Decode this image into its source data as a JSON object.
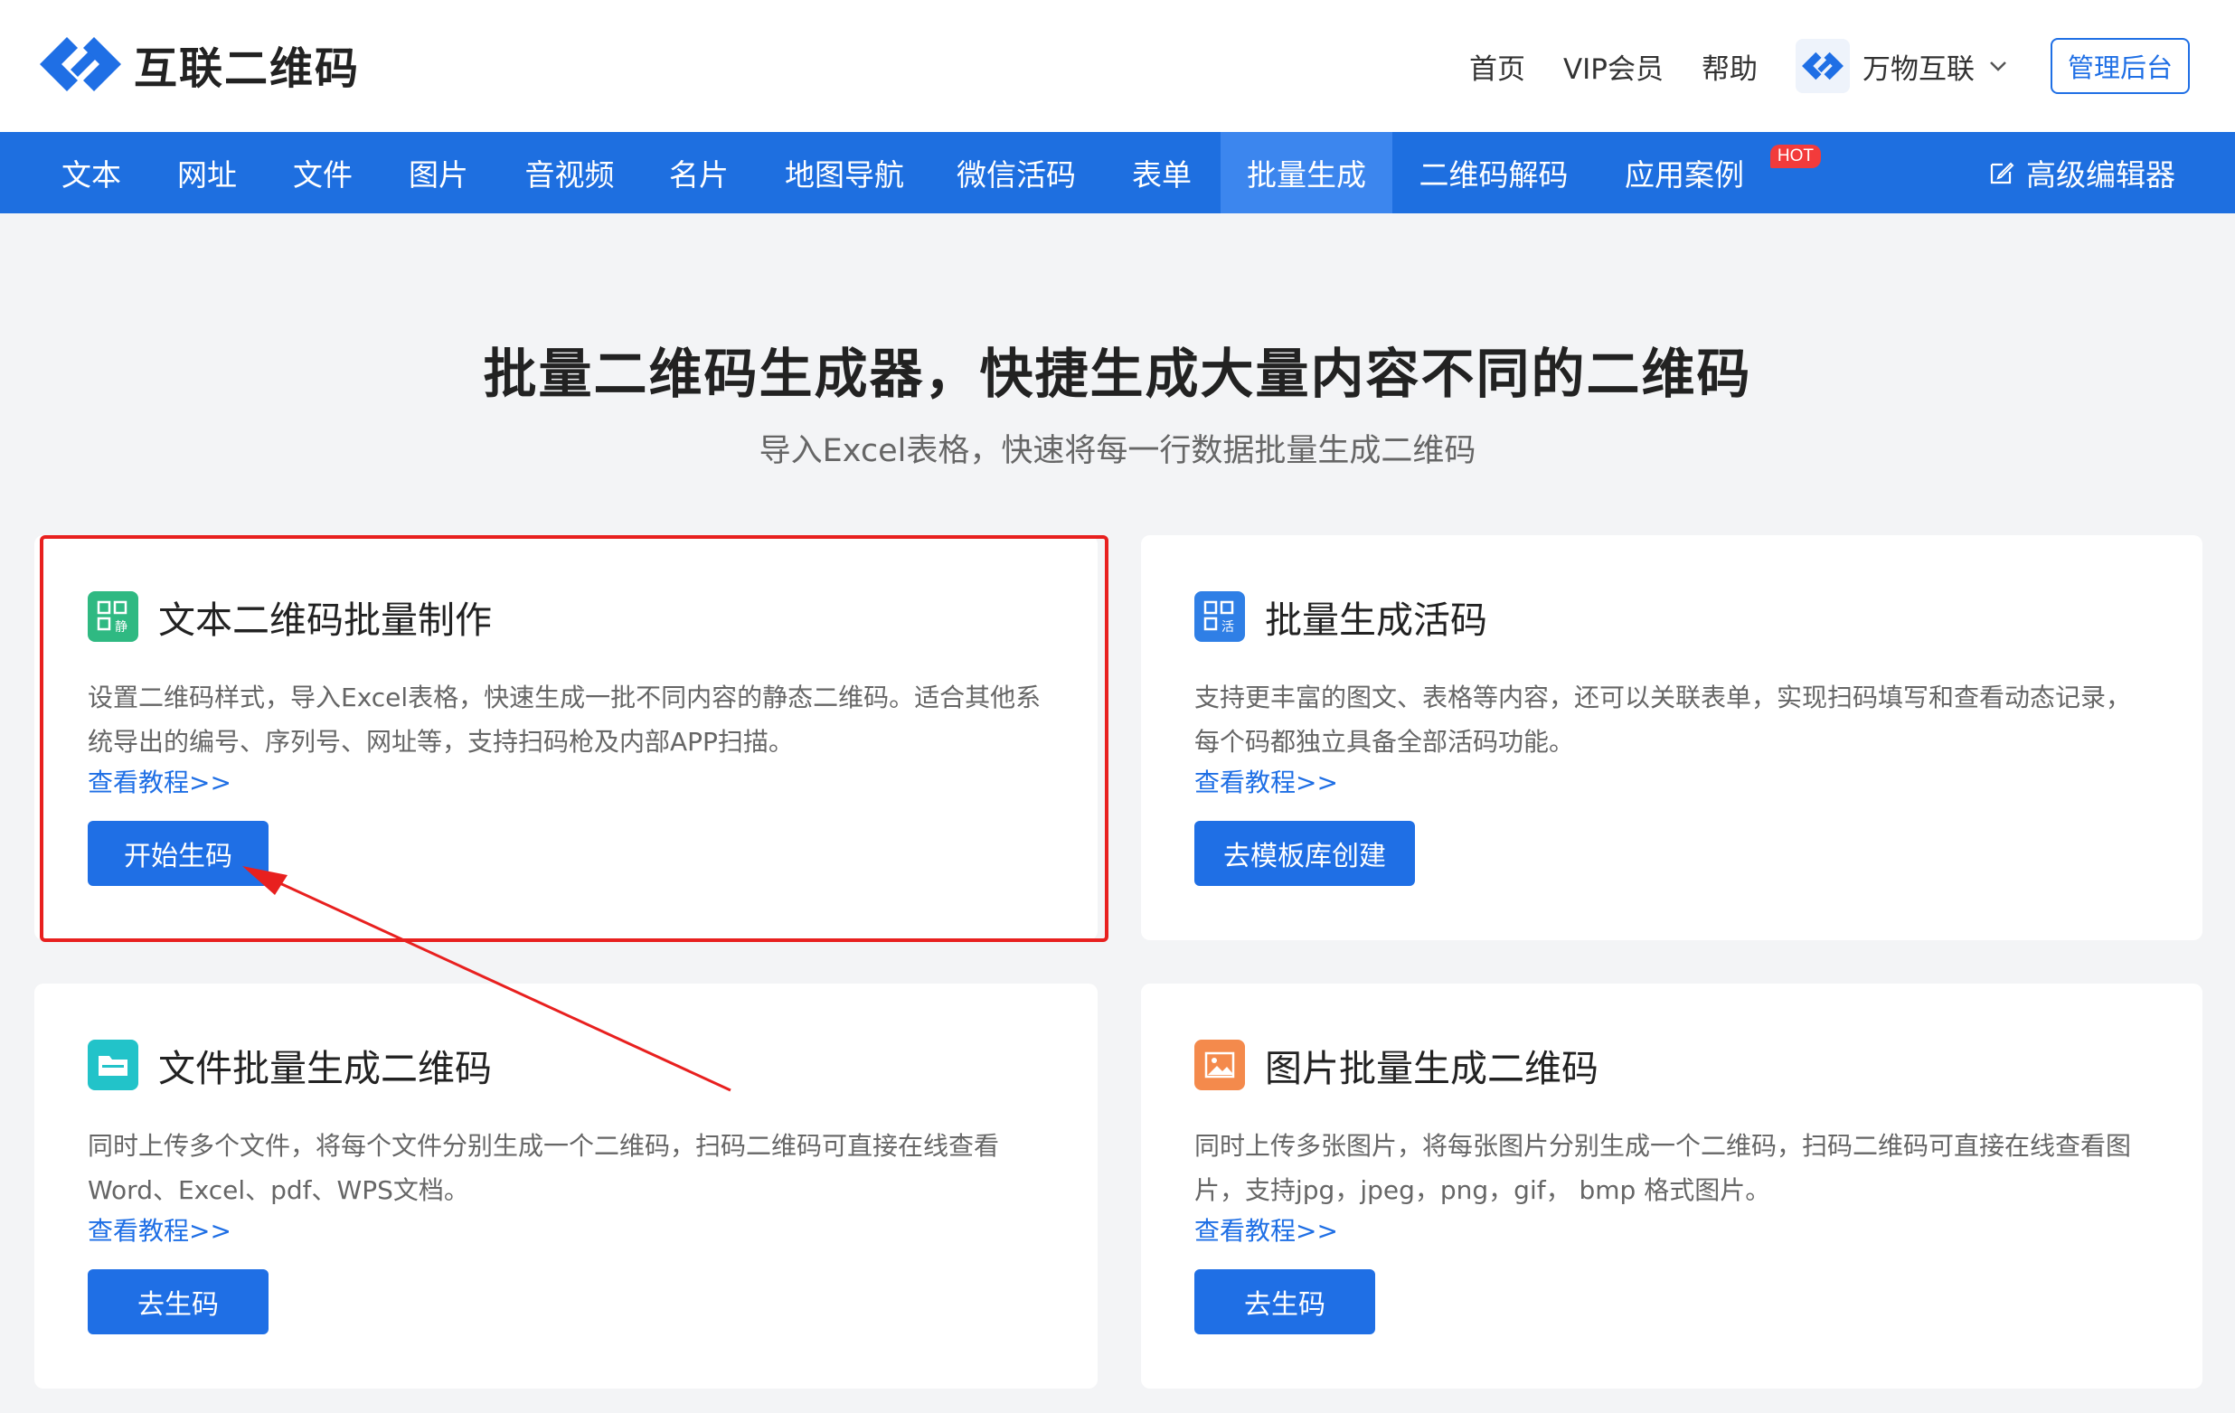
{
  "header": {
    "logo_text": "互联二维码",
    "links": [
      "首页",
      "VIP会员",
      "帮助"
    ],
    "brand_switch": "万物互联",
    "admin_button": "管理后台"
  },
  "nav": {
    "items": [
      "文本",
      "网址",
      "文件",
      "图片",
      "音视频",
      "名片",
      "地图导航",
      "微信活码",
      "表单",
      "批量生成",
      "二维码解码",
      "应用案例"
    ],
    "active": "批量生成",
    "hot_badge": "HOT",
    "advanced_editor": "高级编辑器"
  },
  "hero": {
    "title": "批量二维码生成器，快捷生成大量内容不同的二维码",
    "subtitle": "导入Excel表格，快速将每一行数据批量生成二维码"
  },
  "cards": [
    {
      "title": "文本二维码批量制作",
      "desc": "设置二维码样式，导入Excel表格，快速生成一批不同内容的静态二维码。适合其他系统导出的编号、序列号、网址等，支持扫码枪及内部APP扫描。",
      "link": "查看教程>>",
      "button": "开始生码",
      "icon": "static-qr-icon",
      "icon_color": "#2fb982"
    },
    {
      "title": "批量生成活码",
      "desc": "支持更丰富的图文、表格等内容，还可以关联表单，实现扫码填写和查看动态记录，每个码都独立具备全部活码功能。",
      "link": "查看教程>>",
      "button": "去模板库创建",
      "icon": "live-qr-icon",
      "icon_color": "#2f7fe6"
    },
    {
      "title": "文件批量生成二维码",
      "desc": "同时上传多个文件，将每个文件分别生成一个二维码，扫码二维码可直接在线查看Word、Excel、pdf、WPS文档。",
      "link": "查看教程>>",
      "button": "去生码",
      "icon": "folder-icon",
      "icon_color": "#22c3c9"
    },
    {
      "title": "图片批量生成二维码",
      "desc": "同时上传多张图片，将每张图片分别生成一个二维码，扫码二维码可直接在线查看图片，支持jpg，jpeg，png，gif， bmp 格式图片。",
      "link": "查看教程>>",
      "button": "去生码",
      "icon": "image-icon",
      "icon_color": "#f48a4c"
    }
  ],
  "colors": {
    "primary": "#1f6fe5",
    "nav_bg": "#1e6fe0",
    "annotation_red": "#e8201f"
  }
}
